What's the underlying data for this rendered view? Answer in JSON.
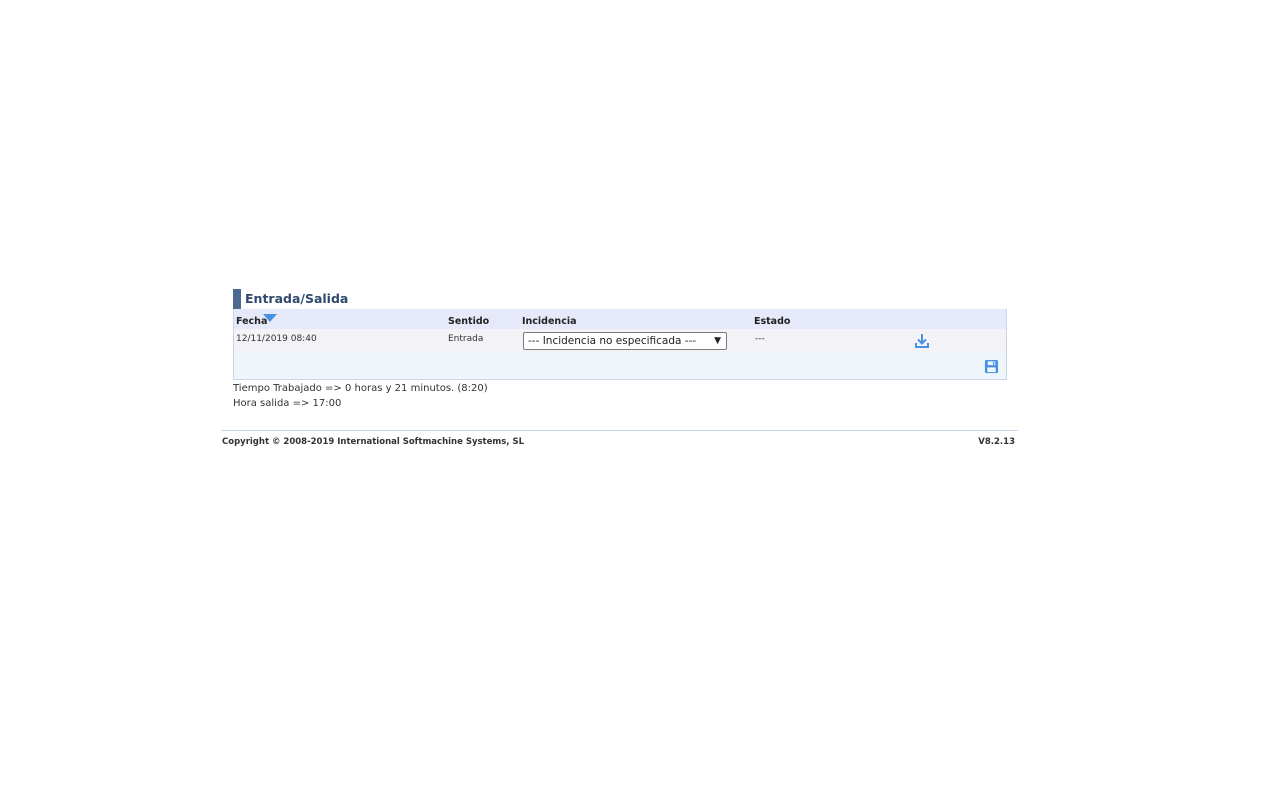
{
  "section": {
    "title": "Entrada/Salida"
  },
  "table": {
    "columns": {
      "fecha": "Fecha",
      "sentido": "Sentido",
      "incidencia": "Incidencia",
      "estado": "Estado"
    },
    "rows": [
      {
        "fecha": "12/11/2019 08:40",
        "sentido": "Entrada",
        "incidencia": "--- Incidencia no especificada ---",
        "estado": "---"
      }
    ]
  },
  "summary": {
    "tiempo_trabajado": "Tiempo Trabajado => 0 horas y 21 minutos. (8:20)",
    "hora_salida": "Hora salida => 17:00"
  },
  "footer": {
    "copyright": "Copyright © 2008-2019 International Softmachine Systems, SL",
    "version": "V8.2.13"
  },
  "icons": {
    "sort": "sort-descending-icon",
    "download": "download-icon",
    "save": "save-icon"
  },
  "colors": {
    "accent": "#4a90e2",
    "title": "#2f4a6d",
    "title_bar": "#4a6a91",
    "header_bg": "#e6e9fa"
  }
}
